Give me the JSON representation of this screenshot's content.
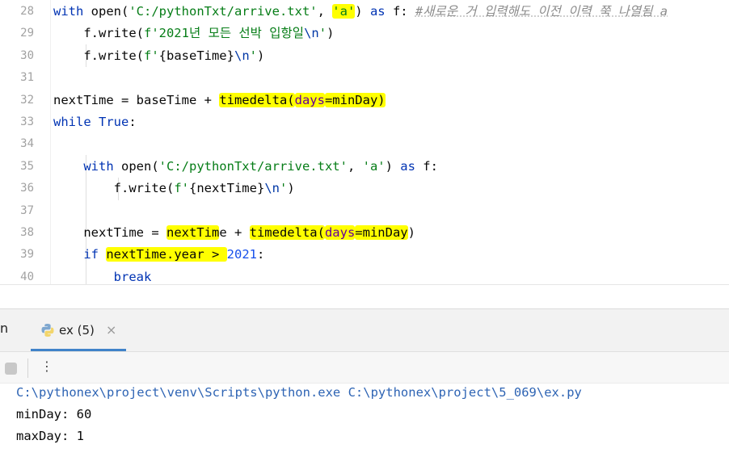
{
  "editor": {
    "lines": [
      {
        "n": "28",
        "tokens": [
          {
            "t": "with",
            "c": "kw"
          },
          {
            "t": " open("
          },
          {
            "t": "'C:/pythonTxt/arrive.txt'",
            "c": "str"
          },
          {
            "t": ", "
          },
          {
            "t": "'a'",
            "c": "str",
            "h": true
          },
          {
            "t": ") "
          },
          {
            "t": "as",
            "c": "kw"
          },
          {
            "t": " f: "
          },
          {
            "t": "#새로운 거 입력해도 이전 이력 쭉 나열됨 a",
            "c": "cmt"
          }
        ]
      },
      {
        "n": "29",
        "tokens": [
          {
            "t": "    f.write("
          },
          {
            "t": "f'2021년 모든 선박 입항일",
            "c": "str"
          },
          {
            "t": "\\n",
            "c": "esc"
          },
          {
            "t": "'",
            "c": "str"
          },
          {
            "t": ")"
          }
        ]
      },
      {
        "n": "30",
        "tokens": [
          {
            "t": "    f.write("
          },
          {
            "t": "f'",
            "c": "str"
          },
          {
            "t": "{baseTime}"
          },
          {
            "t": "\\n",
            "c": "esc"
          },
          {
            "t": "'",
            "c": "str"
          },
          {
            "t": ")"
          }
        ]
      },
      {
        "n": "31",
        "tokens": []
      },
      {
        "n": "32",
        "tokens": [
          {
            "t": "nextTime = baseTime + "
          },
          {
            "t": "timedelta(",
            "h": true
          },
          {
            "t": "days",
            "c": "param",
            "h": true
          },
          {
            "t": "=minDay)",
            "h": true
          }
        ]
      },
      {
        "n": "33",
        "tokens": [
          {
            "t": "while",
            "c": "kw"
          },
          {
            "t": " "
          },
          {
            "t": "True",
            "c": "kw"
          },
          {
            "t": ":"
          }
        ]
      },
      {
        "n": "34",
        "tokens": []
      },
      {
        "n": "35",
        "tokens": [
          {
            "t": "    "
          },
          {
            "t": "with",
            "c": "kw"
          },
          {
            "t": " open("
          },
          {
            "t": "'C:/pythonTxt/arrive.txt'",
            "c": "str"
          },
          {
            "t": ", "
          },
          {
            "t": "'a'",
            "c": "str"
          },
          {
            "t": ") "
          },
          {
            "t": "as",
            "c": "kw"
          },
          {
            "t": " f:"
          }
        ]
      },
      {
        "n": "36",
        "tokens": [
          {
            "t": "        f.write("
          },
          {
            "t": "f'",
            "c": "str"
          },
          {
            "t": "{nextTime}"
          },
          {
            "t": "\\n",
            "c": "esc"
          },
          {
            "t": "'",
            "c": "str"
          },
          {
            "t": ")"
          }
        ]
      },
      {
        "n": "37",
        "tokens": []
      },
      {
        "n": "38",
        "tokens": [
          {
            "t": "    nextTime = "
          },
          {
            "t": "nextTim",
            "h": true
          },
          {
            "t": "e + "
          },
          {
            "t": "timedelta(",
            "h": true
          },
          {
            "t": "days",
            "c": "param",
            "h": true
          },
          {
            "t": "=minDay",
            "h": true
          },
          {
            "t": ")"
          }
        ]
      },
      {
        "n": "39",
        "tokens": [
          {
            "t": "    "
          },
          {
            "t": "if",
            "c": "kw"
          },
          {
            "t": " "
          },
          {
            "t": "nextTime.year > ",
            "h": true
          },
          {
            "t": "2021",
            "c": "num"
          },
          {
            "t": ":"
          }
        ]
      },
      {
        "n": "40",
        "tokens": [
          {
            "t": "        "
          },
          {
            "t": "break",
            "c": "kw"
          }
        ]
      }
    ]
  },
  "run_panel": {
    "label": "n",
    "tab_label": "ex (5)",
    "close_glyph": "×",
    "more_glyph": "⋮"
  },
  "console": {
    "lines": [
      {
        "text": "C:\\pythonex\\project\\venv\\Scripts\\python.exe C:\\pythonex\\project\\5_069\\ex.py",
        "color": "#2e64b4"
      },
      {
        "text": "minDay: 60",
        "color": "#080808"
      },
      {
        "text": "maxDay: 1",
        "color": "#080808"
      }
    ]
  }
}
